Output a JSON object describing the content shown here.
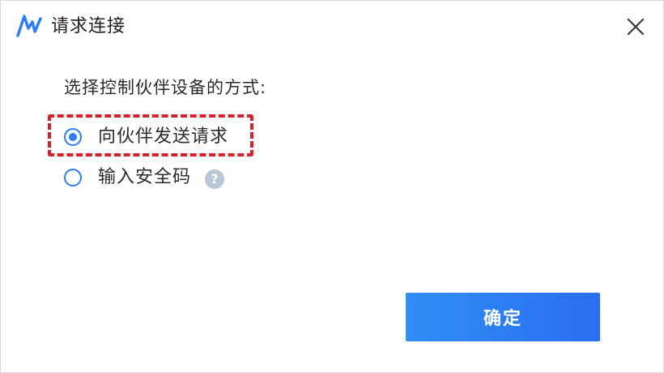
{
  "window": {
    "title": "请求连接",
    "logo_icon": "app-logo-icon",
    "close_icon": "close-icon"
  },
  "prompt": "选择控制伙伴设备的方式:",
  "options": [
    {
      "label": "向伙伴发送请求",
      "selected": true,
      "highlighted": true
    },
    {
      "label": "输入安全码",
      "selected": false,
      "help_icon": "help-icon",
      "help_glyph": "?"
    }
  ],
  "buttons": {
    "confirm_label": "确定"
  },
  "colors": {
    "accent": "#2d7df6",
    "button_gradient_start": "#2f8ff5",
    "button_gradient_end": "#2a6ef0",
    "highlight_border": "#d6202a",
    "help_icon_bg": "#b9c6d6"
  }
}
